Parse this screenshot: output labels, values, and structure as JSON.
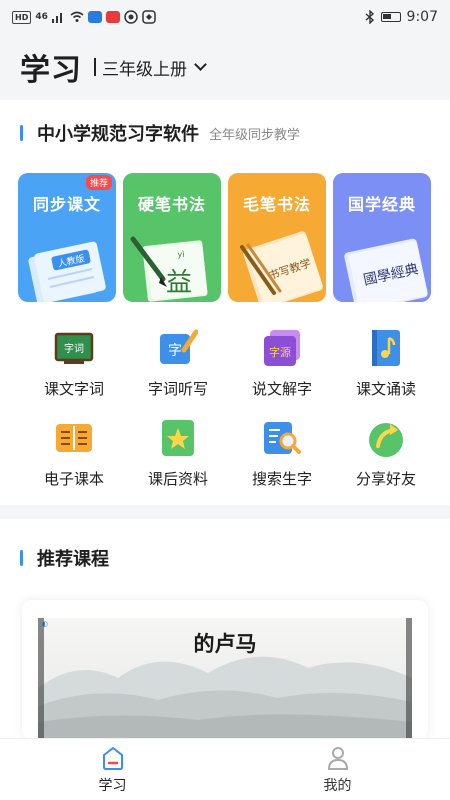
{
  "status_bar": {
    "left_labels": [
      "HD",
      "46"
    ],
    "time": "9:07",
    "icons": [
      "wifi-icon",
      "app-icon",
      "bluetooth-icon",
      "battery-icon"
    ]
  },
  "header": {
    "title": "学习",
    "grade": "三年级上册"
  },
  "intro": {
    "title": "中小学规范习字软件",
    "subtitle": "全年级同步教学"
  },
  "cards": [
    {
      "label": "同步课文",
      "badge": "推荐",
      "color": "#4aa3f5",
      "art_text": "人教版"
    },
    {
      "label": "硬笔书法",
      "color": "#58c46a",
      "art_text": "益",
      "art_pinyin": "yì"
    },
    {
      "label": "毛笔书法",
      "color": "#f6a933",
      "art_text": "书写教学"
    },
    {
      "label": "国学经典",
      "color": "#7b8ff4",
      "art_text": "國學經典"
    }
  ],
  "grid": [
    [
      {
        "label": "课文字词",
        "icon": "blackboard-icon",
        "icon_text": "字词"
      },
      {
        "label": "字词听写",
        "icon": "dictation-icon",
        "icon_text": "字"
      },
      {
        "label": "说文解字",
        "icon": "origin-icon",
        "icon_text": "字源"
      },
      {
        "label": "课文诵读",
        "icon": "music-book-icon"
      }
    ],
    [
      {
        "label": "电子课本",
        "icon": "ebook-icon"
      },
      {
        "label": "课后资料",
        "icon": "star-doc-icon"
      },
      {
        "label": "搜索生字",
        "icon": "search-icon"
      },
      {
        "label": "分享好友",
        "icon": "share-icon"
      }
    ]
  ],
  "recommend": {
    "title": "推荐课程",
    "course_title": "的卢马"
  },
  "bottom_nav": [
    {
      "label": "学习",
      "icon": "study-icon",
      "active": true
    },
    {
      "label": "我的",
      "icon": "profile-icon",
      "active": false
    }
  ],
  "colors": {
    "accent": "#3a8ff0",
    "background": "#f4f5f7"
  }
}
